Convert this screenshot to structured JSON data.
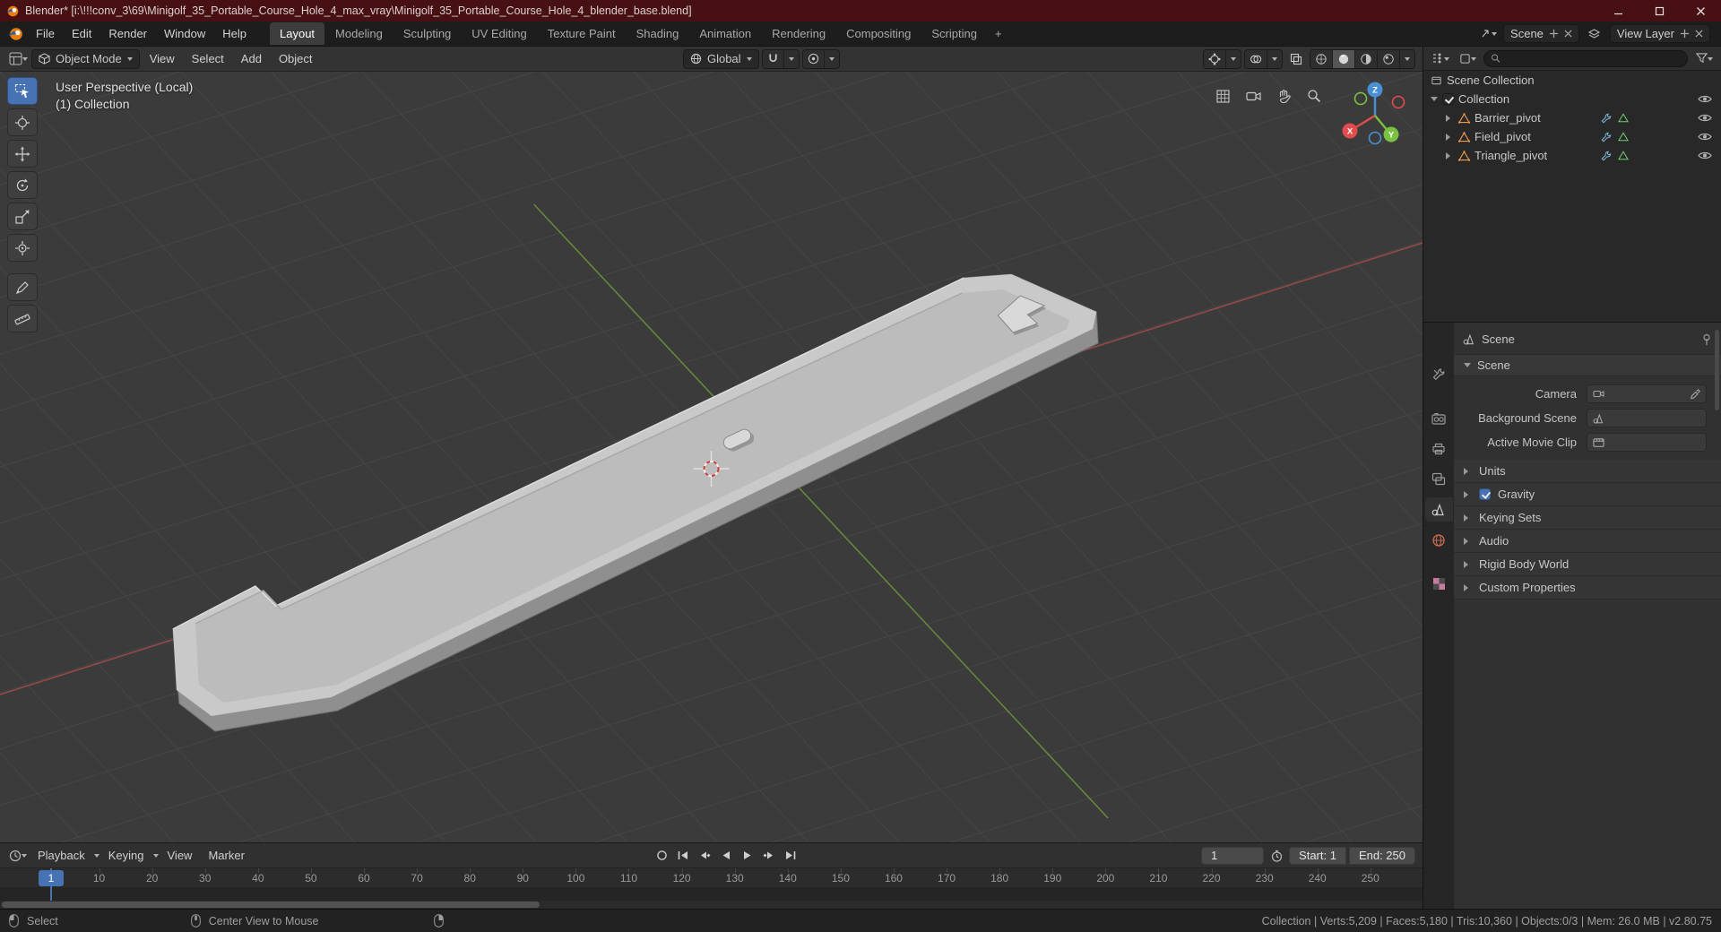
{
  "colors": {
    "accent": "#4772b3",
    "orange": "#e87d0d",
    "axisx": "#e24c4c",
    "axisy": "#7ac142",
    "axisz": "#4a8fd4"
  },
  "titlebar": {
    "title": "Blender* [i:\\!!!conv_3\\69\\Minigolf_35_Portable_Course_Hole_4_max_vray\\Minigolf_35_Portable_Course_Hole_4_blender_base.blend]"
  },
  "menubar": {
    "menus": [
      "File",
      "Edit",
      "Render",
      "Window",
      "Help"
    ],
    "workspaces": [
      "Layout",
      "Modeling",
      "Sculpting",
      "UV Editing",
      "Texture Paint",
      "Shading",
      "Animation",
      "Rendering",
      "Compositing",
      "Scripting"
    ],
    "add_workspace": "+",
    "scene": "Scene",
    "view_layer": "View Layer"
  },
  "tool_header": {
    "mode": "Object Mode",
    "menus": [
      "View",
      "Select",
      "Add",
      "Object"
    ],
    "orientation": "Global"
  },
  "viewport": {
    "overlay_line1": "User Perspective (Local)",
    "overlay_line2": "(1) Collection",
    "gizmo_x": "X",
    "gizmo_y": "Y",
    "gizmo_z": "Z"
  },
  "outliner": {
    "scene_collection": "Scene Collection",
    "collection": "Collection",
    "children": [
      "Barrier_pivot",
      "Field_pivot",
      "Triangle_pivot"
    ]
  },
  "properties": {
    "breadcrumb": "Scene",
    "panel_title": "Scene",
    "camera_label": "Camera",
    "background_scene_label": "Background Scene",
    "active_movie_clip_label": "Active Movie Clip",
    "sections": [
      "Units",
      "Gravity",
      "Keying Sets",
      "Audio",
      "Rigid Body World",
      "Custom Properties"
    ]
  },
  "timeline": {
    "menus": [
      "Playback",
      "Keying",
      "View",
      "Marker"
    ],
    "current_frame": "1",
    "start": "Start: 1",
    "end": "End: 250",
    "ruler": [
      "10",
      "20",
      "30",
      "40",
      "50",
      "60",
      "70",
      "80",
      "90",
      "100",
      "110",
      "120",
      "130",
      "140",
      "150",
      "160",
      "170",
      "180",
      "190",
      "200",
      "210",
      "220",
      "230",
      "240",
      "250"
    ]
  },
  "statusbar": {
    "select": "Select",
    "center_view": "Center View to Mouse",
    "stats": "Collection | Verts:5,209 | Faces:5,180 | Tris:10,360 | Objects:0/3 | Mem: 26.0 MB | v2.80.75"
  }
}
